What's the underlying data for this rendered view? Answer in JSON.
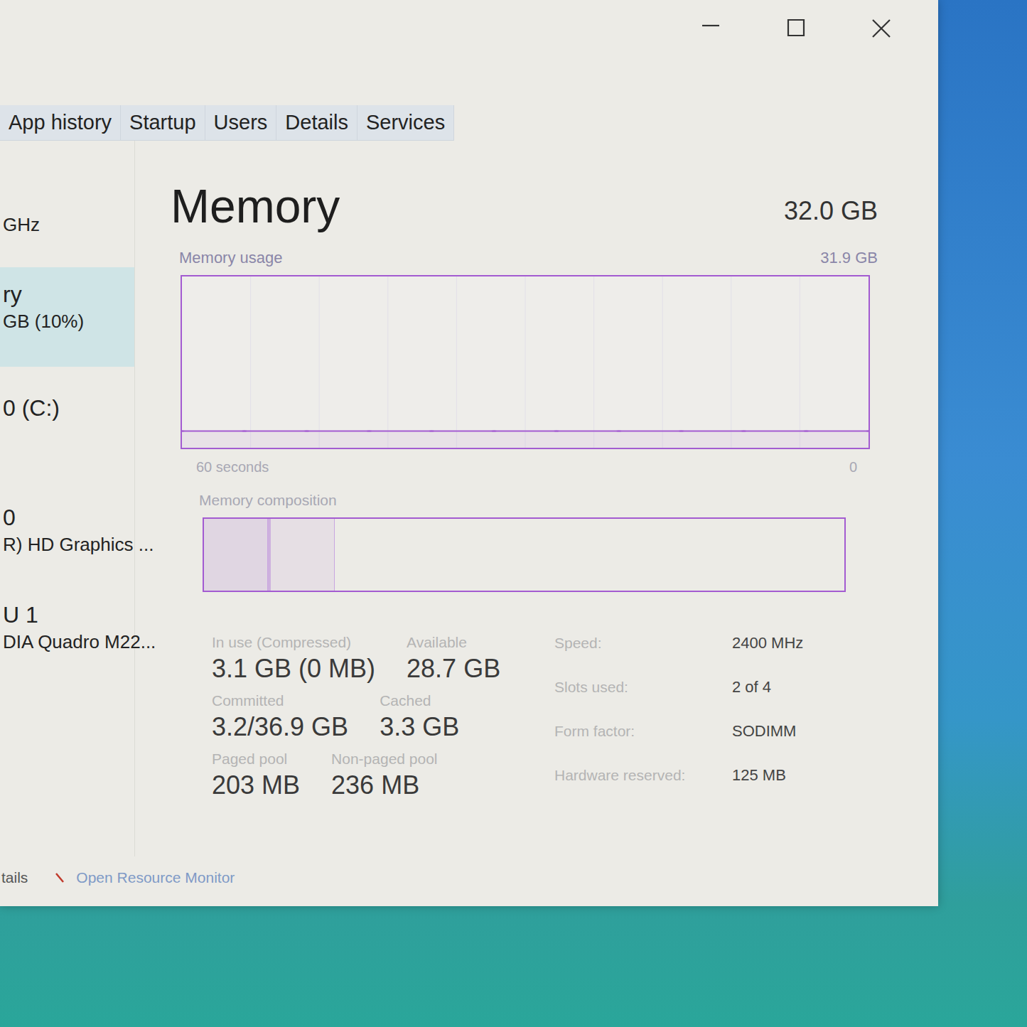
{
  "tabs": [
    {
      "label": "App history",
      "selected": false
    },
    {
      "label": "Startup",
      "selected": false
    },
    {
      "label": "Users",
      "selected": false
    },
    {
      "label": "Details",
      "selected": false
    },
    {
      "label": "Services",
      "selected": false
    }
  ],
  "sidebar": {
    "items": [
      {
        "lines": [
          "GHz"
        ],
        "selected": false
      },
      {
        "lines": [
          "ry",
          "GB (10%)"
        ],
        "selected": true
      },
      {
        "lines": [
          "0 (C:)"
        ],
        "selected": false
      },
      {
        "lines": [
          "0",
          "R) HD Graphics ..."
        ],
        "selected": false
      },
      {
        "lines": [
          "U 1",
          "DIA Quadro M22..."
        ],
        "selected": false
      }
    ]
  },
  "panel": {
    "title": "Memory",
    "total": "32.0 GB",
    "usage_label": "Memory usage",
    "usage_max": "31.9 GB",
    "time_left": "60 seconds",
    "time_right": "0",
    "composition_label": "Memory composition"
  },
  "usage_chart": {
    "max": 31.9,
    "values": [
      3.1,
      3.1,
      3.1,
      3.1,
      3.1,
      3.1,
      3.1,
      3.1,
      3.1,
      3.1,
      3.1,
      3.1
    ]
  },
  "composition": [
    {
      "kind": "inuse",
      "level": 0.1
    },
    {
      "kind": "modified",
      "level": 0.004
    },
    {
      "kind": "standby",
      "level": 0.1
    },
    {
      "kind": "free",
      "level": 0.796
    }
  ],
  "stats": [
    [
      {
        "label": "In use (Compressed)",
        "value": "3.1 GB (0 MB)"
      },
      {
        "label": "Available",
        "value": "28.7 GB"
      }
    ],
    [
      {
        "label": "Committed",
        "value": "3.2/36.9 GB"
      },
      {
        "label": "Cached",
        "value": "3.3 GB"
      }
    ],
    [
      {
        "label": "Paged pool",
        "value": "203 MB"
      },
      {
        "label": "Non-paged pool",
        "value": "236 MB"
      }
    ]
  ],
  "details": [
    {
      "label": "Speed:",
      "value": "2400 MHz"
    },
    {
      "label": "Slots used:",
      "value": "2 of 4"
    },
    {
      "label": "Form factor:",
      "value": "SODIMM"
    },
    {
      "label": "Hardware reserved:",
      "value": "125 MB"
    }
  ],
  "footer": {
    "fewer_details": "tails",
    "resource_monitor": "Open Resource Monitor"
  }
}
